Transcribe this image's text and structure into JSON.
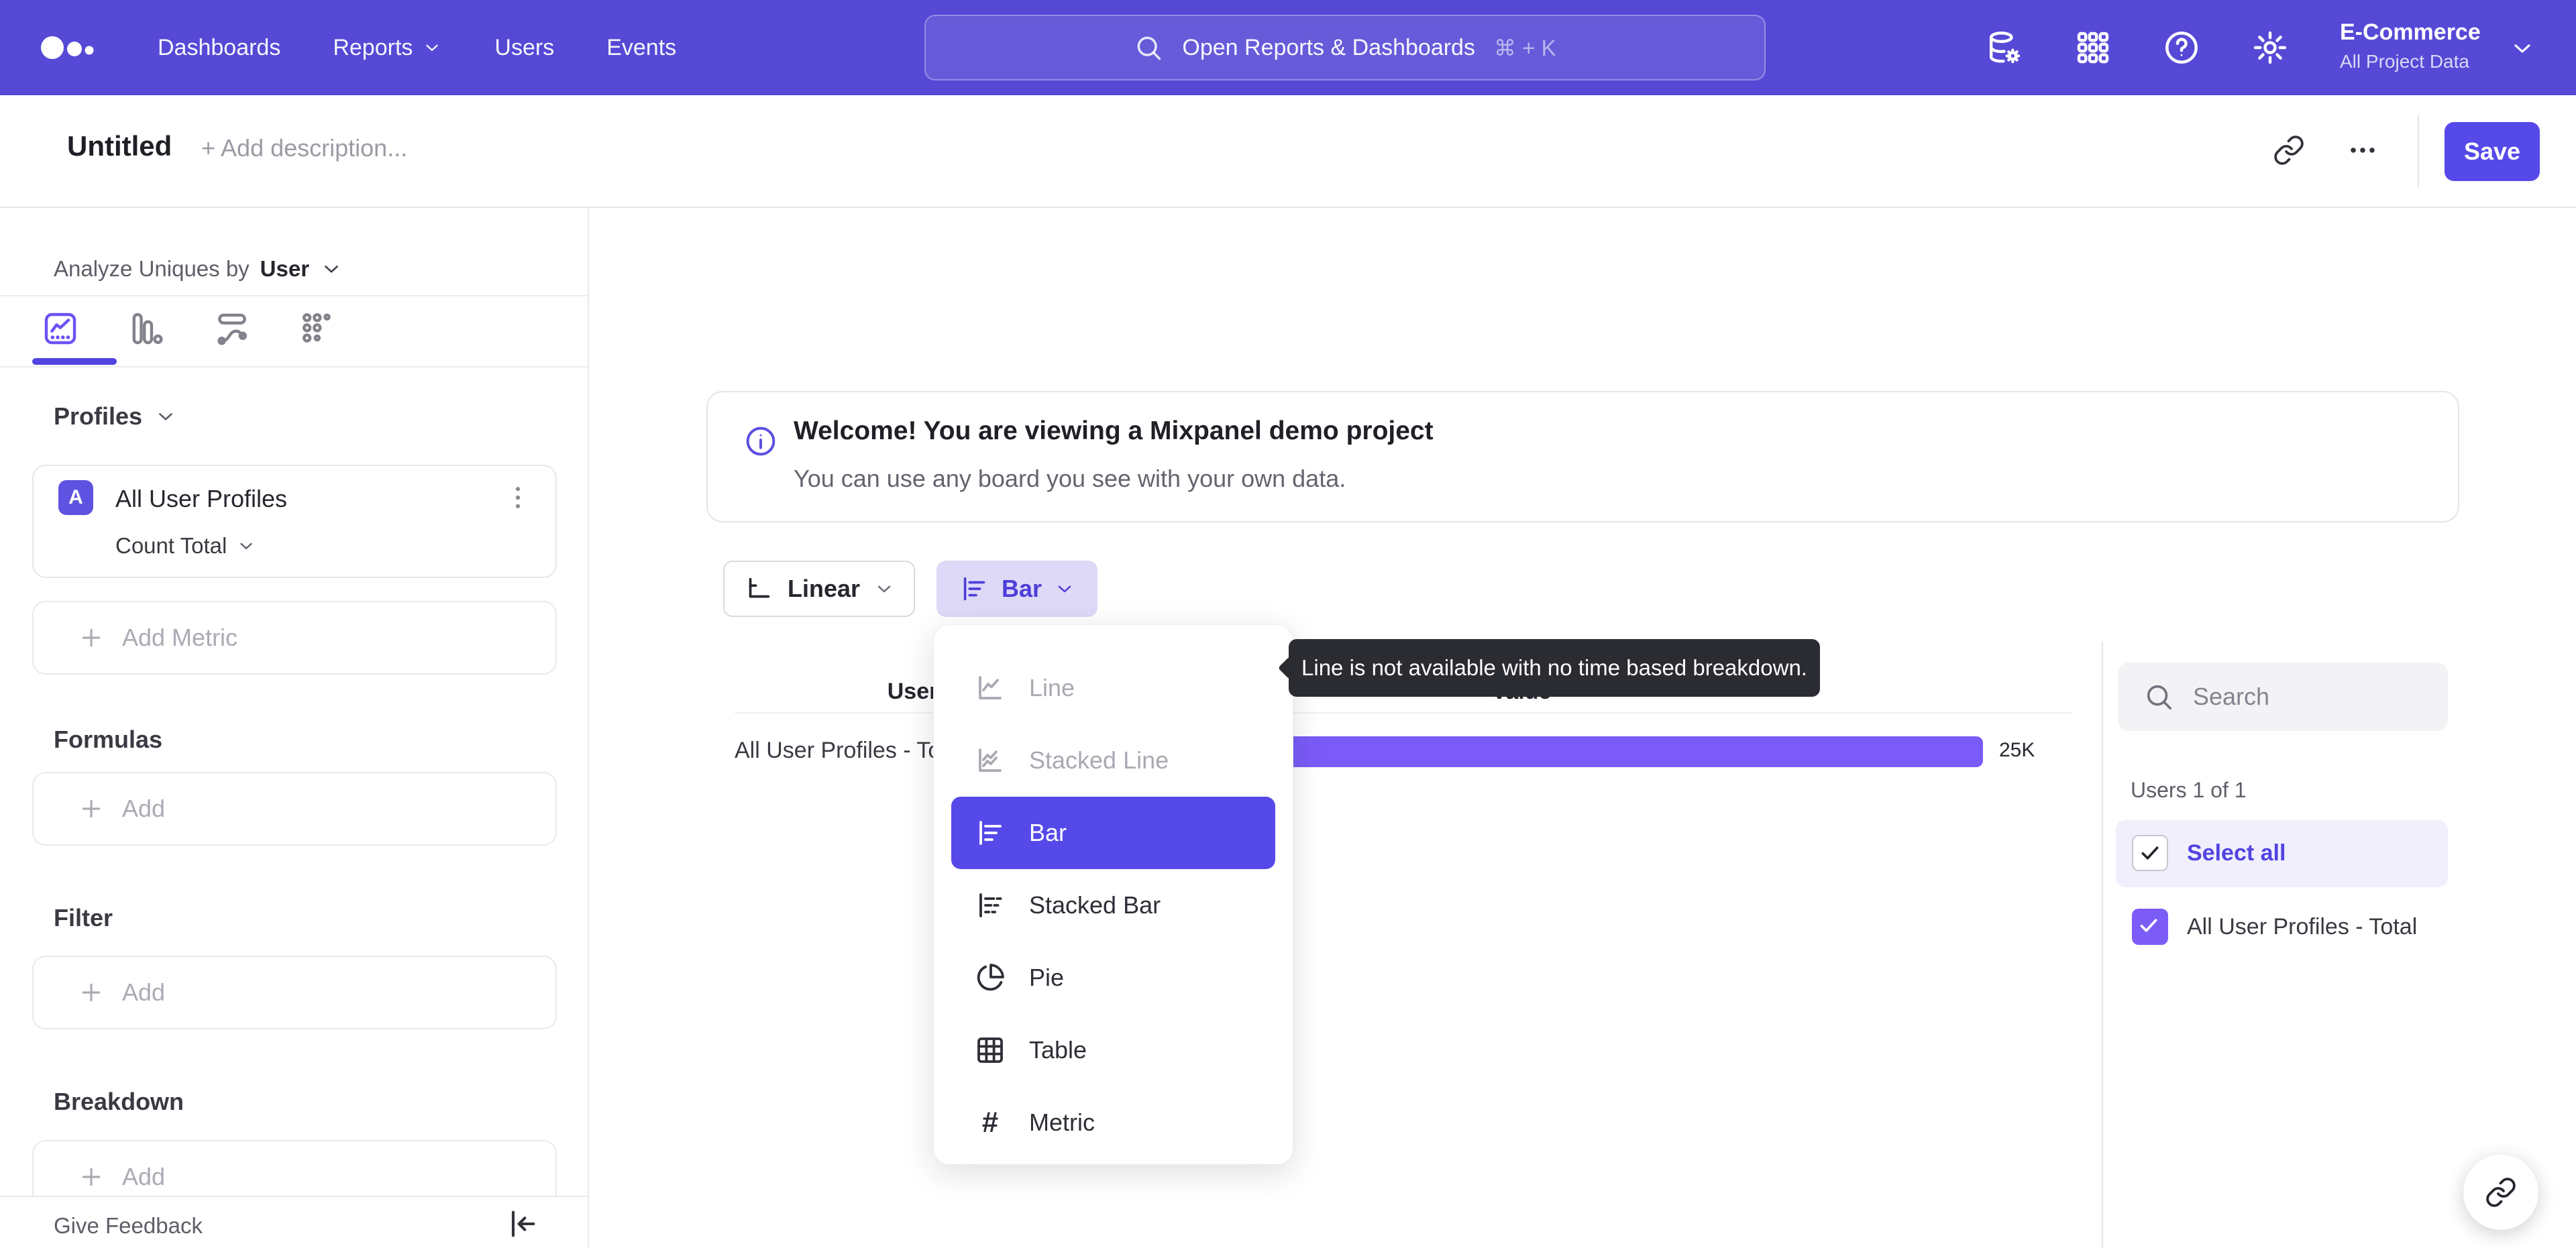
{
  "topnav": {
    "items": [
      {
        "label": "Dashboards"
      },
      {
        "label": "Reports"
      },
      {
        "label": "Users"
      },
      {
        "label": "Events"
      }
    ],
    "search": {
      "placeholder": "Open Reports & Dashboards",
      "shortcut": "⌘ + K"
    },
    "project": {
      "name": "E-Commerce",
      "scope": "All Project Data"
    }
  },
  "header": {
    "title": "Untitled",
    "description_placeholder": "+ Add description...",
    "save_label": "Save"
  },
  "sidebar": {
    "analyze_prefix": "Analyze Uniques by",
    "analyze_value": "User",
    "profiles_title": "Profiles",
    "metric": {
      "badge": "A",
      "name": "All User Profiles",
      "aggregation": "Count Total"
    },
    "add_metric_label": "Add Metric",
    "formulas_title": "Formulas",
    "formulas_add_label": "Add",
    "filter_title": "Filter",
    "filter_add_label": "Add",
    "breakdown_title": "Breakdown",
    "breakdown_add_label": "Add",
    "feedback_label": "Give Feedback"
  },
  "banner": {
    "title": "Welcome! You are viewing a Mixpanel demo project",
    "subtitle": "You can use any board you see with your own data."
  },
  "controls": {
    "scale_label": "Linear",
    "chart_type_label": "Bar"
  },
  "chart_menu": {
    "items": [
      {
        "label": "Line",
        "state": "disabled"
      },
      {
        "label": "Stacked Line",
        "state": "disabled"
      },
      {
        "label": "Bar",
        "state": "selected"
      },
      {
        "label": "Stacked Bar",
        "state": "normal"
      },
      {
        "label": "Pie",
        "state": "normal"
      },
      {
        "label": "Table",
        "state": "normal"
      },
      {
        "label": "Metric",
        "state": "normal"
      }
    ]
  },
  "tooltip": {
    "text": "Line is not available with no time based breakdown."
  },
  "chart_data": {
    "type": "bar",
    "orientation": "horizontal",
    "columns": [
      "Users",
      "Value"
    ],
    "categories": [
      "All User Profiles - Total"
    ],
    "values": [
      25000
    ],
    "value_labels": [
      "25K"
    ],
    "bar_color": "#7A5BF7",
    "legend": "none",
    "grid": "off"
  },
  "right_panel": {
    "search_placeholder": "Search",
    "count_label": "Users 1 of 1",
    "select_all_label": "Select all",
    "item_label": "All User Profiles - Total",
    "item_checked": true
  },
  "colors": {
    "nav_bg": "#5649D6",
    "accent": "#5549E9",
    "bar_fill": "#7A5BF7",
    "chart_type_bg": "#DFD9F8",
    "tooltip_bg": "#2B2B32"
  }
}
